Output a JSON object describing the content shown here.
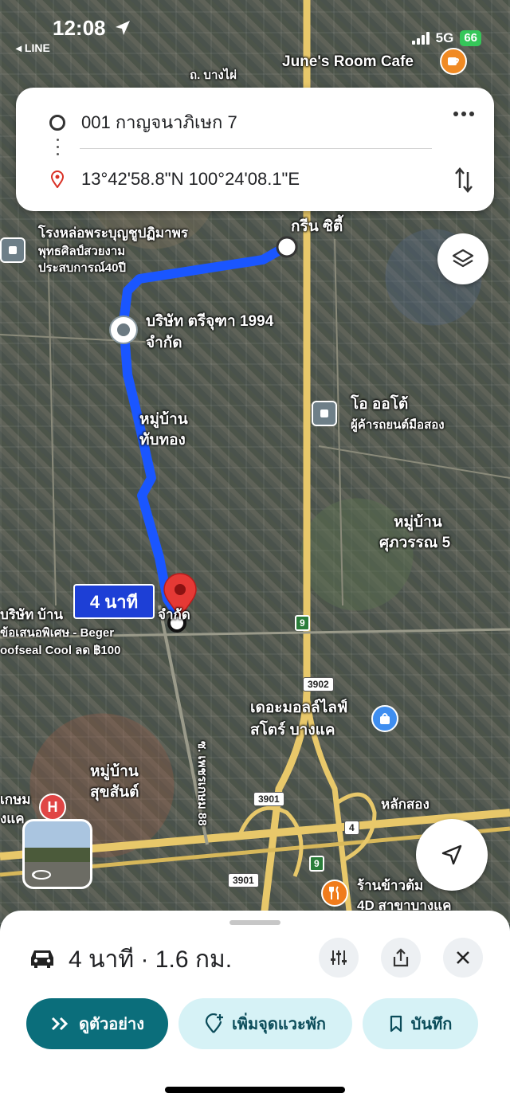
{
  "status_bar": {
    "time": "12:08",
    "back_app": "◂ LINE",
    "network": "5G",
    "battery": "66"
  },
  "directions": {
    "origin": "001 กาญจนาภิเษก 7",
    "destination": "13°42'58.8\"N 100°24'08.1\"E"
  },
  "map": {
    "labels": {
      "cafe": "June's Room Cafe",
      "road_bangphai": "ถ. บางไผ่",
      "green_city": "กรีน ซิตี้",
      "foundry_1": "โรงหล่อพระบุญชูปฏิมาพร",
      "foundry_2": "พุทธศิลป์สวยงาม",
      "foundry_3": "ประสบการณ์40ปี",
      "company_1": "บริษัท ตรีจุฑา 1994",
      "company_2": "จำกัด",
      "village_tubtong_1": "หมู่บ้าน",
      "village_tubtong_2": "ทับทอง",
      "o_auto_1": "โอ ออโต้",
      "o_auto_2": "ผู้ค้ารถยนต์มือสอง",
      "village_supawan_1": "หมู่บ้าน",
      "village_supawan_2": "ศุภวรรณ 5",
      "company_ban": "บริษัท บ้าน",
      "company_ban_end": "จำกัด",
      "promo_1": "ข้อเสนอพิเศษ - Beger",
      "promo_2": "oofseal Cool ลด ฿100",
      "mall_1": "เดอะมอลล์ไลฟ์",
      "mall_2": "สโตร์ บางแค",
      "road_phetkasem": "ซ. เพชรเกษม 88",
      "village_suksan_1": "หมู่บ้าน",
      "village_suksan_2": "สุขสันต์",
      "hospital_1": "เกษม",
      "hospital_2": "งแค",
      "laksong": "หลักสอง",
      "rice_shop_1": "ร้านข้าวต้ม",
      "rice_shop_2": "4D สาขาบางแค"
    },
    "route_badges": {
      "r9": "9",
      "r3902": "3902",
      "r3901": "3901",
      "r4": "4"
    },
    "travel_time_label": "4 นาที",
    "route_color": "#1a56ff",
    "pin_color": "#e53935"
  },
  "sheet": {
    "trip_summary": "4 นาที · 1.6 กม.",
    "preview_label": "ดูตัวอย่าง",
    "add_stop_label": "เพิ่มจุดแวะพัก",
    "save_label": "บันทึก"
  },
  "colors": {
    "primary": "#0b6e7b",
    "secondary_bg": "#d6f2f6"
  }
}
